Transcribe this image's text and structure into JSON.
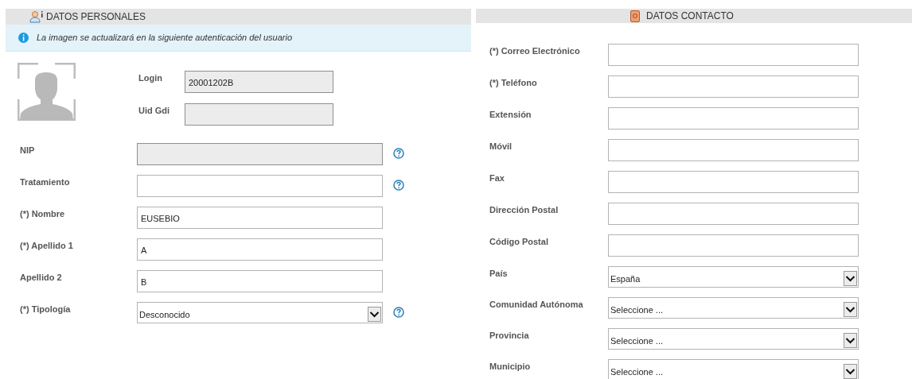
{
  "personal": {
    "title": "DATOS PERSONALES",
    "notice": "La imagen se actualizará en la siguiente autenticación del usuario",
    "account_fields": [
      {
        "label": "Login",
        "value": "20001202B",
        "disabled": true
      },
      {
        "label": "Uid Gdi",
        "disabled": true
      }
    ],
    "fields": [
      {
        "label": "NIP",
        "kind": "text",
        "disabled": true,
        "help": true
      },
      {
        "label": "Tratamiento",
        "kind": "text",
        "disabled": false,
        "help": true
      },
      {
        "label": "(*) Nombre",
        "kind": "text",
        "value": "EUSEBIO",
        "disabled": false,
        "help": false
      },
      {
        "label": "(*) Apellido 1",
        "kind": "text",
        "value": "A",
        "disabled": false,
        "help": false
      },
      {
        "label": "Apellido 2",
        "kind": "text",
        "value": "B",
        "disabled": false,
        "help": false
      },
      {
        "label": "(*) Tipología",
        "kind": "select",
        "value": "Desconocido",
        "disabled": false,
        "help": true
      }
    ]
  },
  "contact": {
    "title": "DATOS CONTACTO",
    "fields": [
      {
        "label": "(*) Correo Electrónico",
        "kind": "text"
      },
      {
        "label": "(*) Teléfono",
        "kind": "text"
      },
      {
        "label": "Extensión",
        "kind": "text"
      },
      {
        "label": "Móvil",
        "kind": "text"
      },
      {
        "label": "Fax",
        "kind": "text"
      },
      {
        "label": "Dirección Postal",
        "kind": "text"
      },
      {
        "label": "Código Postal",
        "kind": "text"
      },
      {
        "label": "País",
        "kind": "select",
        "value": "España"
      },
      {
        "label": "Comunidad Autónoma",
        "kind": "select",
        "value": "Seleccione ..."
      },
      {
        "label": "Provincia",
        "kind": "select",
        "value": "Seleccione ..."
      },
      {
        "label": "Municipio",
        "kind": "select",
        "value": "Seleccione ..."
      }
    ]
  }
}
